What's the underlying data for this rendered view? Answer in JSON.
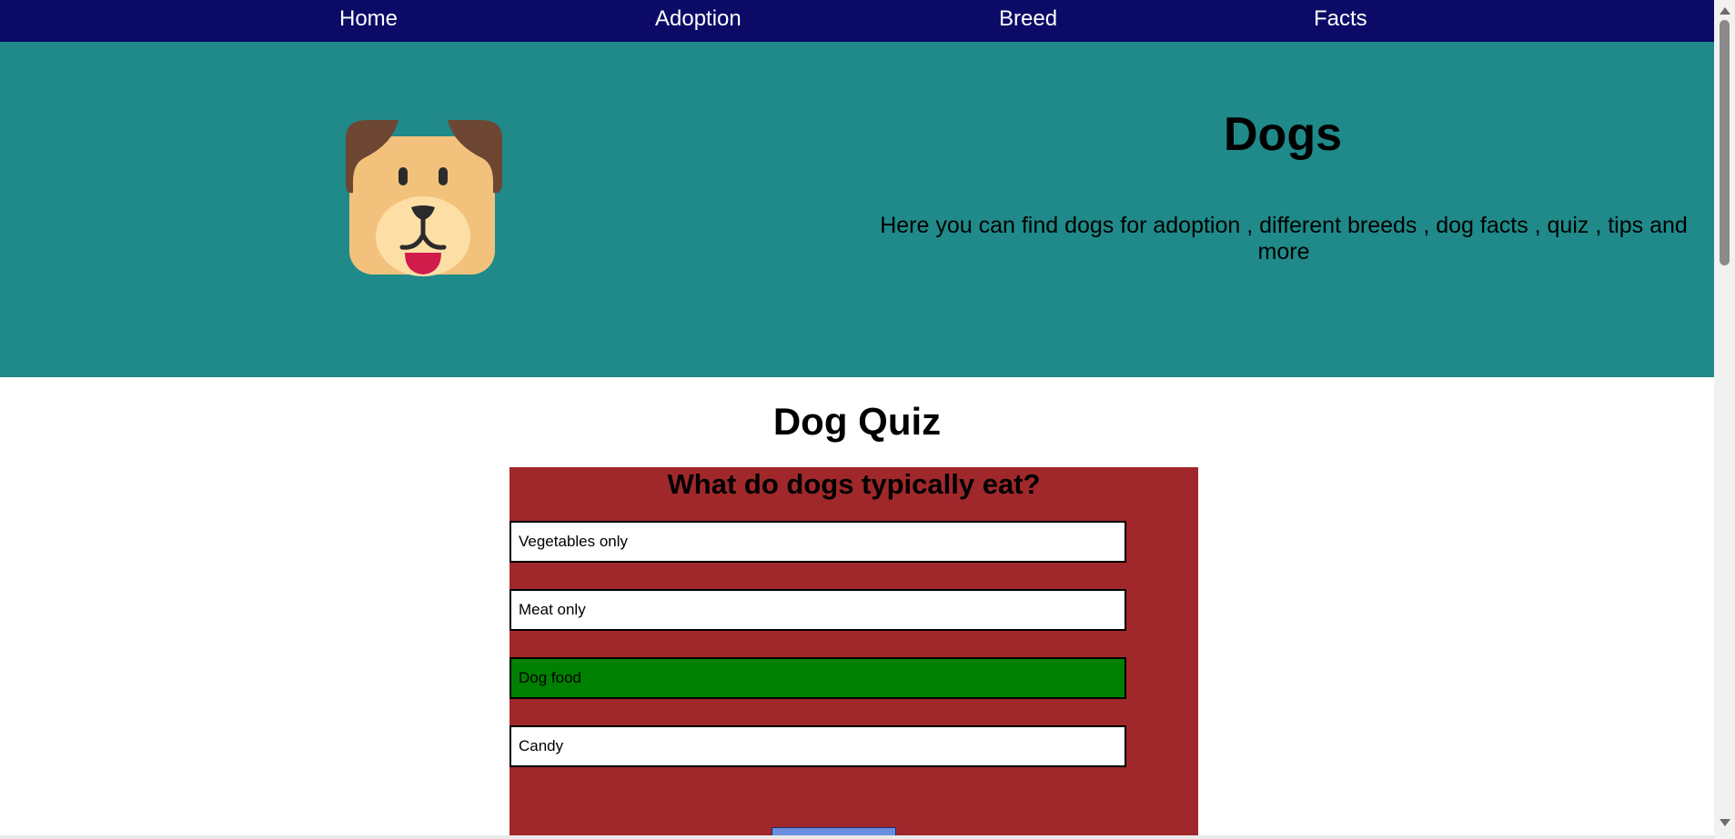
{
  "nav": {
    "items": [
      {
        "label": "Home"
      },
      {
        "label": "Adoption"
      },
      {
        "label": "Breed"
      },
      {
        "label": "Facts"
      }
    ]
  },
  "hero": {
    "logo_icon": "dog-face-icon",
    "title": "Dogs",
    "description": "Here you can find dogs for adoption , different breeds , dog facts , quiz , tips and more"
  },
  "quiz": {
    "title": "Dog Quiz",
    "question": "What do dogs typically eat?",
    "answers": [
      {
        "label": "Vegetables only",
        "state": "default"
      },
      {
        "label": "Meat only",
        "state": "default"
      },
      {
        "label": "Dog food",
        "state": "correct"
      },
      {
        "label": "Candy",
        "state": "default"
      }
    ],
    "submit_label": ""
  },
  "colors": {
    "nav_bg": "#0b0a66",
    "hero_bg": "#1f8a89",
    "quiz_bg": "#a0282a",
    "correct": "#008000",
    "submit_bg": "#6a8fe0"
  }
}
